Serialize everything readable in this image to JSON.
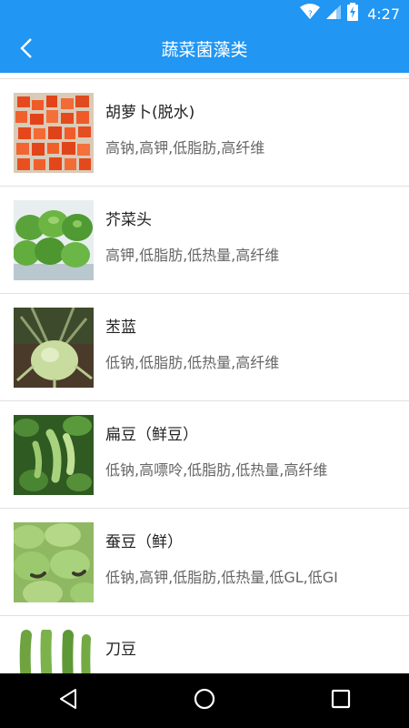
{
  "status_bar": {
    "time": "4:27"
  },
  "app_bar": {
    "title": "蔬菜菌藻类",
    "back_icon": "chevron-left-icon"
  },
  "items": [
    {
      "name": "胡萝卜(脱水)",
      "tags": "高钠,高钾,低脂肪,高纤维"
    },
    {
      "name": "芥菜头",
      "tags": "高钾,低脂肪,低热量,高纤维"
    },
    {
      "name": "苤蓝",
      "tags": "低钠,低脂肪,低热量,高纤维"
    },
    {
      "name": "扁豆（鲜豆）",
      "tags": "低钠,高嘌呤,低脂肪,低热量,高纤维"
    },
    {
      "name": "蚕豆（鲜）",
      "tags": "低钠,高钾,低脂肪,低热量,低GL,低GI"
    },
    {
      "name": "刀豆",
      "tags": ""
    }
  ],
  "nav_bar": {
    "back": "triangle-back-icon",
    "home": "circle-home-icon",
    "recents": "square-recents-icon"
  },
  "colors": {
    "primary": "#2196f3",
    "divider": "#e0e0e0",
    "text_primary": "#222222",
    "text_secondary": "#666666"
  }
}
